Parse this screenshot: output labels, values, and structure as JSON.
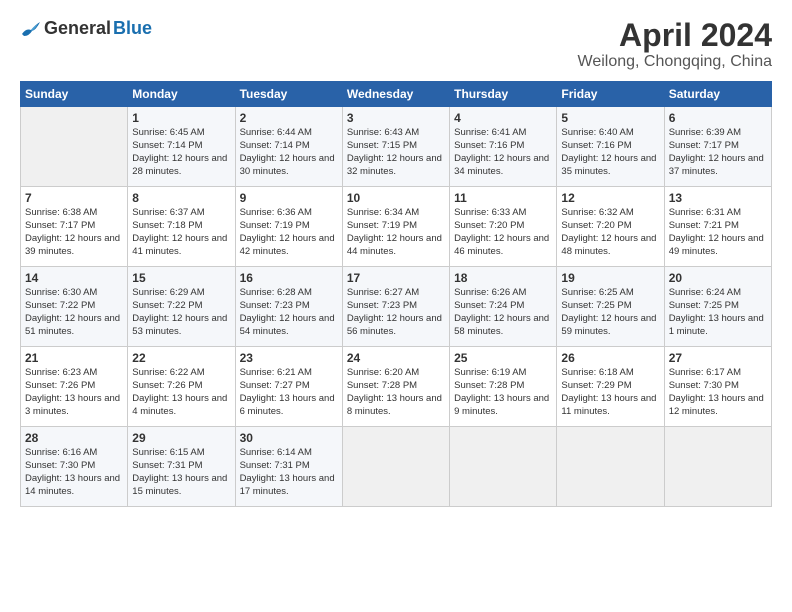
{
  "header": {
    "logo_general": "General",
    "logo_blue": "Blue",
    "title": "April 2024",
    "subtitle": "Weilong, Chongqing, China"
  },
  "columns": [
    "Sunday",
    "Monday",
    "Tuesday",
    "Wednesday",
    "Thursday",
    "Friday",
    "Saturday"
  ],
  "rows": [
    [
      {
        "empty": true
      },
      {
        "day": "1",
        "sunrise": "Sunrise: 6:45 AM",
        "sunset": "Sunset: 7:14 PM",
        "daylight": "Daylight: 12 hours and 28 minutes."
      },
      {
        "day": "2",
        "sunrise": "Sunrise: 6:44 AM",
        "sunset": "Sunset: 7:14 PM",
        "daylight": "Daylight: 12 hours and 30 minutes."
      },
      {
        "day": "3",
        "sunrise": "Sunrise: 6:43 AM",
        "sunset": "Sunset: 7:15 PM",
        "daylight": "Daylight: 12 hours and 32 minutes."
      },
      {
        "day": "4",
        "sunrise": "Sunrise: 6:41 AM",
        "sunset": "Sunset: 7:16 PM",
        "daylight": "Daylight: 12 hours and 34 minutes."
      },
      {
        "day": "5",
        "sunrise": "Sunrise: 6:40 AM",
        "sunset": "Sunset: 7:16 PM",
        "daylight": "Daylight: 12 hours and 35 minutes."
      },
      {
        "day": "6",
        "sunrise": "Sunrise: 6:39 AM",
        "sunset": "Sunset: 7:17 PM",
        "daylight": "Daylight: 12 hours and 37 minutes."
      }
    ],
    [
      {
        "day": "7",
        "sunrise": "Sunrise: 6:38 AM",
        "sunset": "Sunset: 7:17 PM",
        "daylight": "Daylight: 12 hours and 39 minutes."
      },
      {
        "day": "8",
        "sunrise": "Sunrise: 6:37 AM",
        "sunset": "Sunset: 7:18 PM",
        "daylight": "Daylight: 12 hours and 41 minutes."
      },
      {
        "day": "9",
        "sunrise": "Sunrise: 6:36 AM",
        "sunset": "Sunset: 7:19 PM",
        "daylight": "Daylight: 12 hours and 42 minutes."
      },
      {
        "day": "10",
        "sunrise": "Sunrise: 6:34 AM",
        "sunset": "Sunset: 7:19 PM",
        "daylight": "Daylight: 12 hours and 44 minutes."
      },
      {
        "day": "11",
        "sunrise": "Sunrise: 6:33 AM",
        "sunset": "Sunset: 7:20 PM",
        "daylight": "Daylight: 12 hours and 46 minutes."
      },
      {
        "day": "12",
        "sunrise": "Sunrise: 6:32 AM",
        "sunset": "Sunset: 7:20 PM",
        "daylight": "Daylight: 12 hours and 48 minutes."
      },
      {
        "day": "13",
        "sunrise": "Sunrise: 6:31 AM",
        "sunset": "Sunset: 7:21 PM",
        "daylight": "Daylight: 12 hours and 49 minutes."
      }
    ],
    [
      {
        "day": "14",
        "sunrise": "Sunrise: 6:30 AM",
        "sunset": "Sunset: 7:22 PM",
        "daylight": "Daylight: 12 hours and 51 minutes."
      },
      {
        "day": "15",
        "sunrise": "Sunrise: 6:29 AM",
        "sunset": "Sunset: 7:22 PM",
        "daylight": "Daylight: 12 hours and 53 minutes."
      },
      {
        "day": "16",
        "sunrise": "Sunrise: 6:28 AM",
        "sunset": "Sunset: 7:23 PM",
        "daylight": "Daylight: 12 hours and 54 minutes."
      },
      {
        "day": "17",
        "sunrise": "Sunrise: 6:27 AM",
        "sunset": "Sunset: 7:23 PM",
        "daylight": "Daylight: 12 hours and 56 minutes."
      },
      {
        "day": "18",
        "sunrise": "Sunrise: 6:26 AM",
        "sunset": "Sunset: 7:24 PM",
        "daylight": "Daylight: 12 hours and 58 minutes."
      },
      {
        "day": "19",
        "sunrise": "Sunrise: 6:25 AM",
        "sunset": "Sunset: 7:25 PM",
        "daylight": "Daylight: 12 hours and 59 minutes."
      },
      {
        "day": "20",
        "sunrise": "Sunrise: 6:24 AM",
        "sunset": "Sunset: 7:25 PM",
        "daylight": "Daylight: 13 hours and 1 minute."
      }
    ],
    [
      {
        "day": "21",
        "sunrise": "Sunrise: 6:23 AM",
        "sunset": "Sunset: 7:26 PM",
        "daylight": "Daylight: 13 hours and 3 minutes."
      },
      {
        "day": "22",
        "sunrise": "Sunrise: 6:22 AM",
        "sunset": "Sunset: 7:26 PM",
        "daylight": "Daylight: 13 hours and 4 minutes."
      },
      {
        "day": "23",
        "sunrise": "Sunrise: 6:21 AM",
        "sunset": "Sunset: 7:27 PM",
        "daylight": "Daylight: 13 hours and 6 minutes."
      },
      {
        "day": "24",
        "sunrise": "Sunrise: 6:20 AM",
        "sunset": "Sunset: 7:28 PM",
        "daylight": "Daylight: 13 hours and 8 minutes."
      },
      {
        "day": "25",
        "sunrise": "Sunrise: 6:19 AM",
        "sunset": "Sunset: 7:28 PM",
        "daylight": "Daylight: 13 hours and 9 minutes."
      },
      {
        "day": "26",
        "sunrise": "Sunrise: 6:18 AM",
        "sunset": "Sunset: 7:29 PM",
        "daylight": "Daylight: 13 hours and 11 minutes."
      },
      {
        "day": "27",
        "sunrise": "Sunrise: 6:17 AM",
        "sunset": "Sunset: 7:30 PM",
        "daylight": "Daylight: 13 hours and 12 minutes."
      }
    ],
    [
      {
        "day": "28",
        "sunrise": "Sunrise: 6:16 AM",
        "sunset": "Sunset: 7:30 PM",
        "daylight": "Daylight: 13 hours and 14 minutes."
      },
      {
        "day": "29",
        "sunrise": "Sunrise: 6:15 AM",
        "sunset": "Sunset: 7:31 PM",
        "daylight": "Daylight: 13 hours and 15 minutes."
      },
      {
        "day": "30",
        "sunrise": "Sunrise: 6:14 AM",
        "sunset": "Sunset: 7:31 PM",
        "daylight": "Daylight: 13 hours and 17 minutes."
      },
      {
        "empty": true
      },
      {
        "empty": true
      },
      {
        "empty": true
      },
      {
        "empty": true
      }
    ]
  ]
}
